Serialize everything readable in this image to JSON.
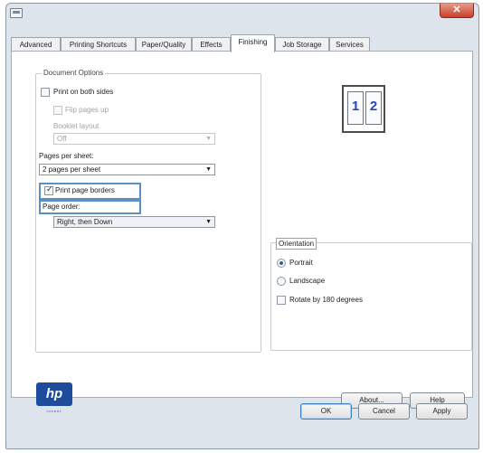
{
  "titlebar": {
    "close_label": "✕"
  },
  "tabs": [
    {
      "label": "Advanced"
    },
    {
      "label": "Printing Shortcuts"
    },
    {
      "label": "Paper/Quality"
    },
    {
      "label": "Effects"
    },
    {
      "label": "Finishing"
    },
    {
      "label": "Job Storage"
    },
    {
      "label": "Services"
    }
  ],
  "active_tab": "Finishing",
  "document_options": {
    "legend": "Document Options",
    "print_both_sides": {
      "label": "Print on both sides",
      "checked": false
    },
    "flip_pages_up": {
      "label": "Flip pages up",
      "checked": false,
      "disabled": true
    },
    "booklet_layout": {
      "label": "Booklet layout",
      "value": "Off",
      "disabled": true
    },
    "pages_per_sheet": {
      "label": "Pages per sheet:",
      "value": "2 pages per sheet"
    },
    "print_page_borders": {
      "label": "Print page borders",
      "checked": true
    },
    "page_order": {
      "label": "Page order:",
      "value": "Right, then Down"
    }
  },
  "preview": {
    "page_one": "1",
    "page_two": "2"
  },
  "orientation": {
    "legend": "Orientation",
    "portrait": {
      "label": "Portrait",
      "selected": true
    },
    "landscape": {
      "label": "Landscape",
      "selected": false
    },
    "rotate": {
      "label": "Rotate by 180 degrees",
      "checked": false
    }
  },
  "logo": {
    "text": "hp",
    "tagline": "invent"
  },
  "buttons": {
    "about": "About...",
    "help": "Help",
    "ok": "OK",
    "cancel": "Cancel",
    "apply": "Apply"
  },
  "colors": {
    "window_frame": "#dde4ec",
    "close_button": "#c8402a",
    "highlight": "#5a90c4",
    "hp_blue": "#1d4c9c",
    "preview_number": "#2446c8"
  }
}
